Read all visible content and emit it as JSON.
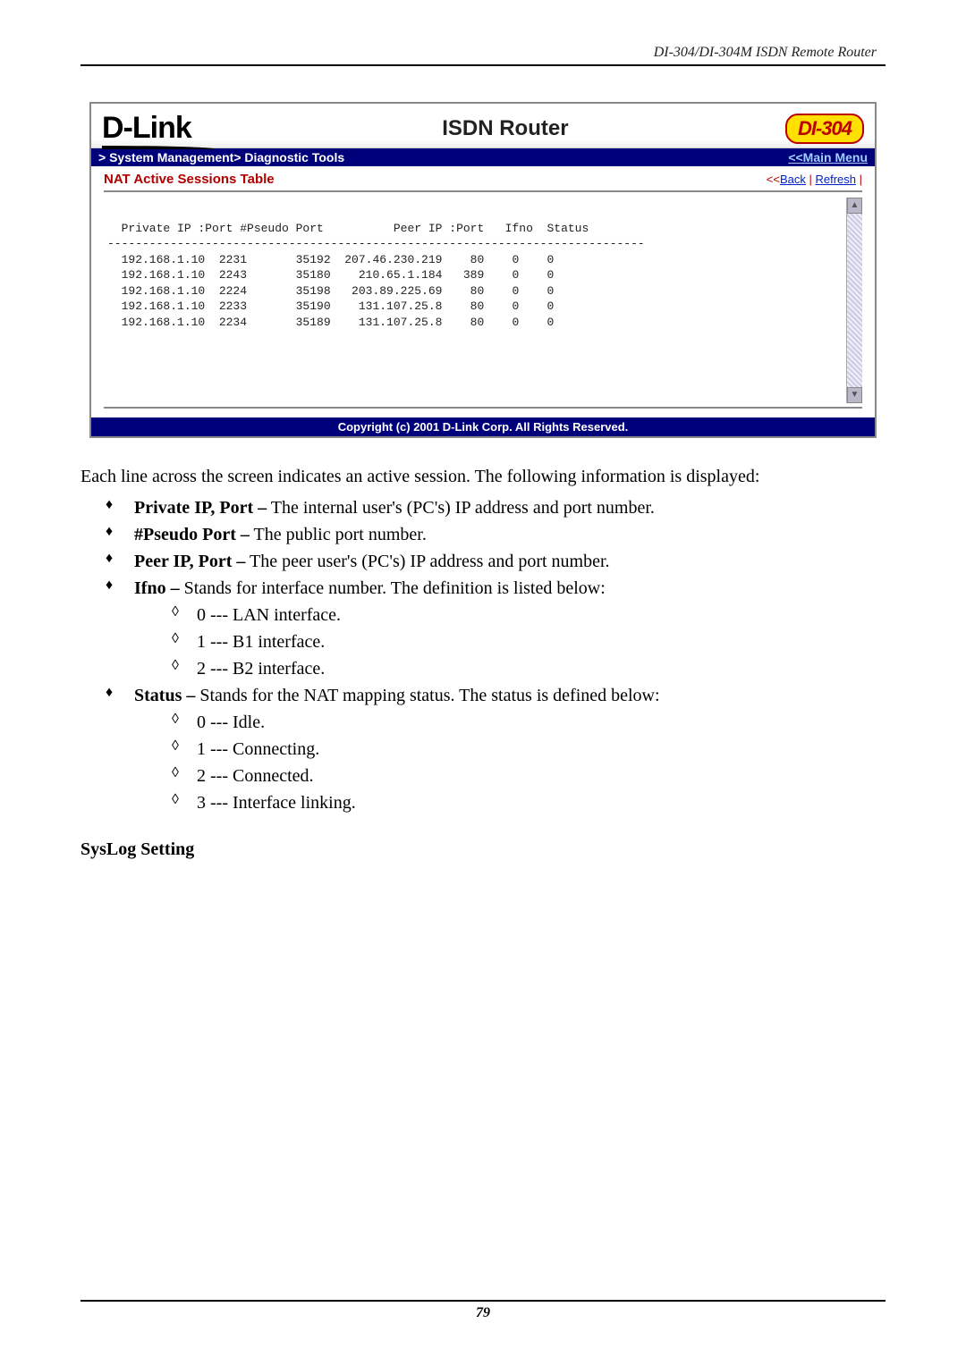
{
  "page": {
    "header_text": "DI-304/DI-304M ISDN Remote Router",
    "number": "79"
  },
  "screenshot": {
    "logo": "D-Link",
    "title": "ISDN Router",
    "model": "DI-304",
    "breadcrumb": "> System Management> Diagnostic Tools",
    "main_menu_label": "<<Main Menu",
    "panel_title": "NAT Active Sessions Table",
    "back_label": "Back",
    "refresh_label": "Refresh",
    "table_header": "  Private IP :Port #Pseudo Port          Peer IP :Port   Ifno  Status",
    "table_divider": "-----------------------------------------------------------------------------",
    "rows": [
      "  192.168.1.10  2231       35192  207.46.230.219    80    0    0",
      "  192.168.1.10  2243       35180    210.65.1.184   389    0    0",
      "  192.168.1.10  2224       35198   203.89.225.69    80    0    0",
      "  192.168.1.10  2233       35190    131.107.25.8    80    0    0",
      "  192.168.1.10  2234       35189    131.107.25.8    80    0    0"
    ],
    "copyright": "Copyright (c) 2001 D-Link Corp. All Rights Reserved."
  },
  "body": {
    "intro": "Each line across the screen indicates an active session. The following information is displayed:",
    "bullets": {
      "b1_term": "Private IP, Port –",
      "b1_desc": " The internal user's (PC's) IP address and port number.",
      "b2_term": "#Pseudo Port –",
      "b2_desc": " The public port number.",
      "b3_term": "Peer IP, Port –",
      "b3_desc": " The peer user's (PC's) IP address and port number.",
      "b4_term": "Ifno –",
      "b4_desc": " Stands for interface number. The definition is listed below:",
      "b4_sub": [
        "0 --- LAN interface.",
        "1 --- B1 interface.",
        "2 --- B2 interface."
      ],
      "b5_term": "Status –",
      "b5_desc": " Stands for the NAT mapping status. The status is defined below:",
      "b5_sub": [
        "0 --- Idle.",
        "1 --- Connecting.",
        "2 --- Connected.",
        "3 --- Interface linking."
      ]
    },
    "syslog_heading": "SysLog Setting"
  },
  "chart_data": {
    "type": "table",
    "title": "NAT Active Sessions Table",
    "columns": [
      "Private IP",
      "Port",
      "#Pseudo Port",
      "Peer IP",
      "Port",
      "Ifno",
      "Status"
    ],
    "rows": [
      [
        "192.168.1.10",
        2231,
        35192,
        "207.46.230.219",
        80,
        0,
        0
      ],
      [
        "192.168.1.10",
        2243,
        35180,
        "210.65.1.184",
        389,
        0,
        0
      ],
      [
        "192.168.1.10",
        2224,
        35198,
        "203.89.225.69",
        80,
        0,
        0
      ],
      [
        "192.168.1.10",
        2233,
        35190,
        "131.107.25.8",
        80,
        0,
        0
      ],
      [
        "192.168.1.10",
        2234,
        35189,
        "131.107.25.8",
        80,
        0,
        0
      ]
    ]
  }
}
